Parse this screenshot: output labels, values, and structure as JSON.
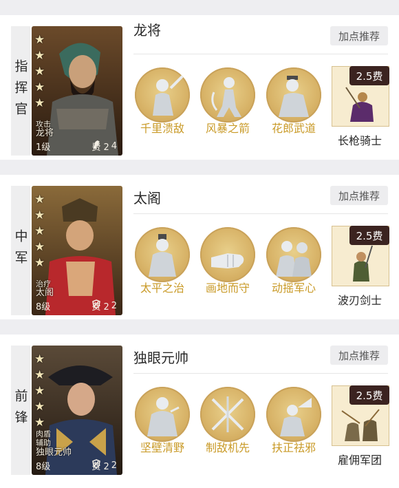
{
  "recommend_label": "加点推荐",
  "sections": [
    {
      "side_label": "指挥官",
      "hero": {
        "type": "攻击",
        "type2": "",
        "name": "龙将",
        "level": "1级",
        "cost": "费 2",
        "troop": "4",
        "troop_icon": "horse-icon"
      },
      "title": "龙将",
      "skills": [
        "千里溃敌",
        "风暴之箭",
        "花郎武道"
      ],
      "unit": {
        "name": "长枪骑士",
        "cost": "2.5费"
      }
    },
    {
      "side_label": "中军",
      "hero": {
        "type": "治疗",
        "type2": "",
        "name": "太阁",
        "level": "8级",
        "cost": "费 2",
        "troop": "2",
        "troop_icon": "shield-icon"
      },
      "title": "太阁",
      "skills": [
        "太平之治",
        "画地而守",
        "动摇军心"
      ],
      "unit": {
        "name": "波刃剑士",
        "cost": "2.5费"
      }
    },
    {
      "side_label": "前锋",
      "hero": {
        "type": "肉盾",
        "type2": "辅助",
        "name": "独眼元帅",
        "level": "8级",
        "cost": "费 2",
        "troop": "2",
        "troop_icon": "shield-icon"
      },
      "title": "独眼元帅",
      "skills": [
        "坚壁清野",
        "制敌机先",
        "扶正祛邪"
      ],
      "unit": {
        "name": "雇佣军团",
        "cost": "2.5费"
      }
    }
  ]
}
